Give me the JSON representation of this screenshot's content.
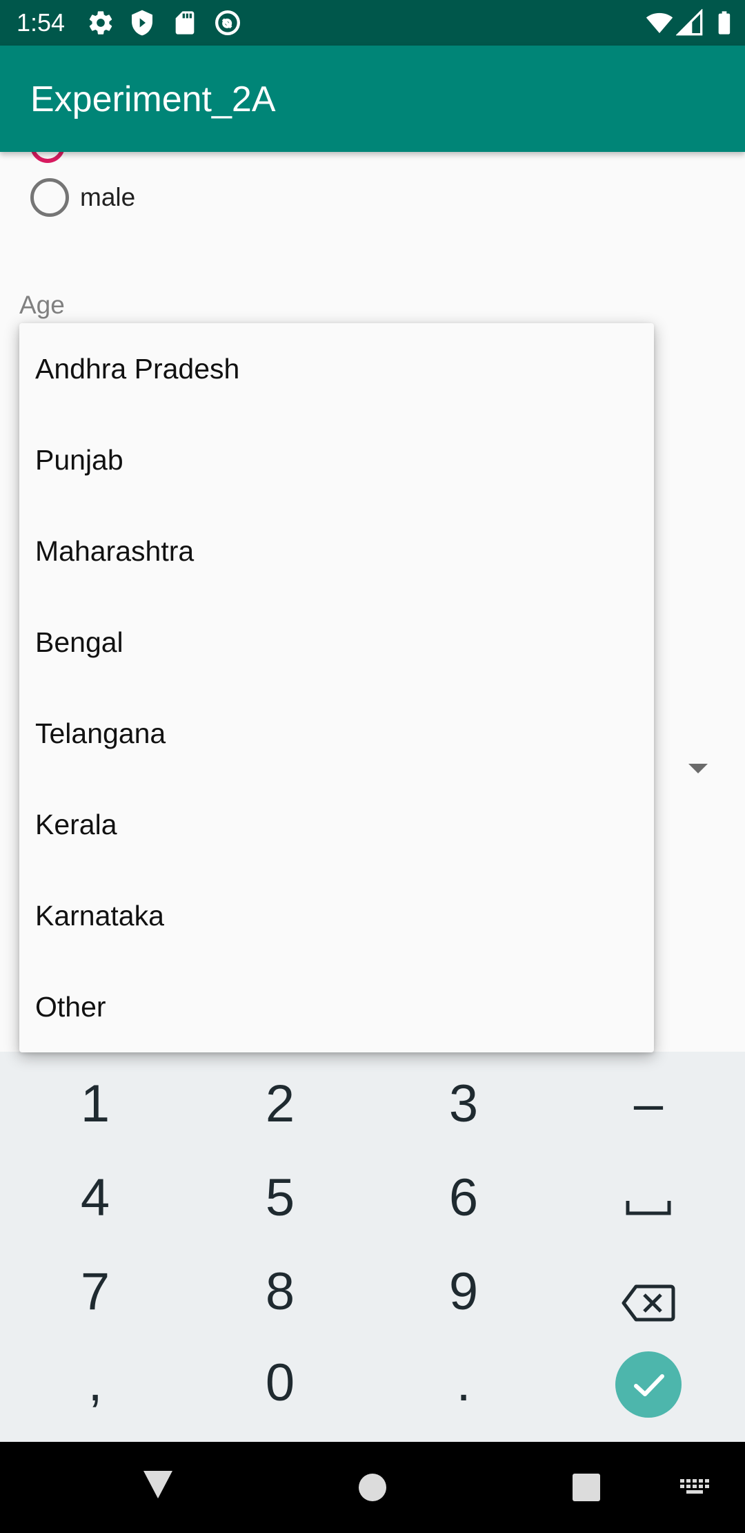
{
  "status_bar": {
    "time": "1:54",
    "left_icons": [
      "gear-icon",
      "shield-icon",
      "sd-card-icon",
      "at-sign-icon"
    ],
    "right_icons": [
      "wifi-icon",
      "cell-signal-icon",
      "battery-icon"
    ]
  },
  "app_bar": {
    "title": "Experiment_2A",
    "color": "#008577"
  },
  "form": {
    "gender_option_male": "male",
    "age_label": "Age",
    "accent_color": "#d81b60"
  },
  "spinner_dropdown": {
    "items": [
      "Andhra Pradesh",
      "Punjab",
      "Maharashtra",
      "Bengal",
      "Telangana",
      "Kerala",
      "Karnataka",
      "Other"
    ]
  },
  "keyboard": {
    "rows": [
      [
        "1",
        "2",
        "3",
        "–"
      ],
      [
        "4",
        "5",
        "6",
        "space-icon"
      ],
      [
        "7",
        "8",
        "9",
        "backspace-icon"
      ],
      [
        ",",
        "0",
        ".",
        "done-icon"
      ]
    ],
    "done_color": "#4db6ac"
  },
  "nav_bar": {
    "icons": [
      "back-icon",
      "home-icon",
      "recents-icon",
      "keyboard-switch-icon"
    ]
  }
}
